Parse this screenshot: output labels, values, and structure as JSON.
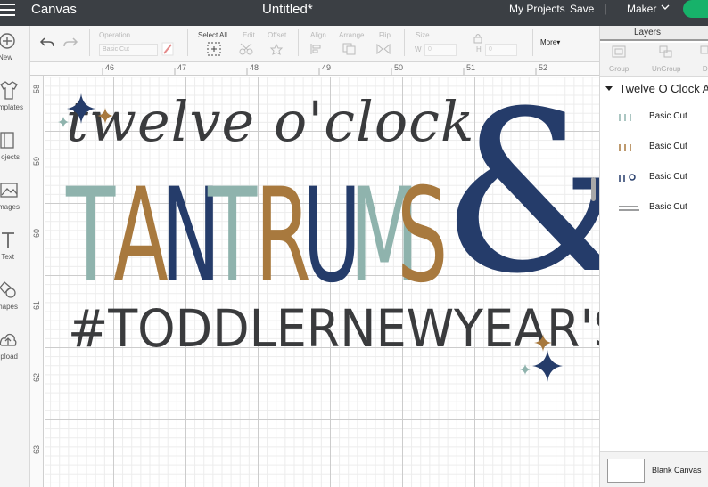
{
  "topbar": {
    "app_title": "Canvas",
    "document_title": "Untitled*",
    "my_projects": "My Projects",
    "save": "Save",
    "separator": "|",
    "machine": "Maker"
  },
  "sidebar": {
    "items": [
      {
        "label": "New",
        "icon": "plus-circle-icon"
      },
      {
        "label": "mplates",
        "icon": "shirt-icon"
      },
      {
        "label": "ojects",
        "icon": "book-icon"
      },
      {
        "label": "mages",
        "icon": "image-icon"
      },
      {
        "label": "Text",
        "icon": "text-t-icon"
      },
      {
        "label": "hapes",
        "icon": "shapes-icon"
      },
      {
        "label": "pload",
        "icon": "cloud-upload-icon"
      }
    ]
  },
  "toolbar": {
    "operation_label": "Operation",
    "operation_value": "Basic Cut",
    "select_all": "Select All",
    "edit": "Edit",
    "offset": "Offset",
    "align": "Align",
    "arrange": "Arrange",
    "flip": "Flip",
    "size": "Size",
    "width_label": "W",
    "height_label": "H",
    "width_value": "0",
    "height_value": "0",
    "more": "More▾"
  },
  "rulers": {
    "top": [
      "46",
      "47",
      "48",
      "49",
      "50",
      "51",
      "52"
    ],
    "left": [
      "58",
      "59",
      "60",
      "61",
      "62",
      "63"
    ]
  },
  "design": {
    "script_text": "twelve o'clock",
    "block_letters": [
      "T",
      "A",
      "N",
      "T",
      "R",
      "U",
      "M",
      "S"
    ],
    "ampersand": "&",
    "hashtag_text": "#TODDLERNEWYEAR'S",
    "colors": {
      "charcoal": "#3a3b3d",
      "sage": "#8fb3ad",
      "mustard": "#a8793e",
      "navy": "#253c6a"
    },
    "block_colors": [
      "#8fb3ad",
      "#a8793e",
      "#253c6a",
      "#8fb3ad",
      "#a8793e",
      "#253c6a",
      "#8fb3ad",
      "#a8793e"
    ]
  },
  "layers": {
    "title": "Layers",
    "tools": [
      "Group",
      "UnGroup",
      "Du"
    ],
    "group_name": "Twelve O Clock A",
    "items": [
      {
        "name": "Basic Cut"
      },
      {
        "name": "Basic Cut"
      },
      {
        "name": "Basic Cut"
      },
      {
        "name": "Basic Cut"
      }
    ],
    "blank_canvas": "Blank Canvas"
  }
}
